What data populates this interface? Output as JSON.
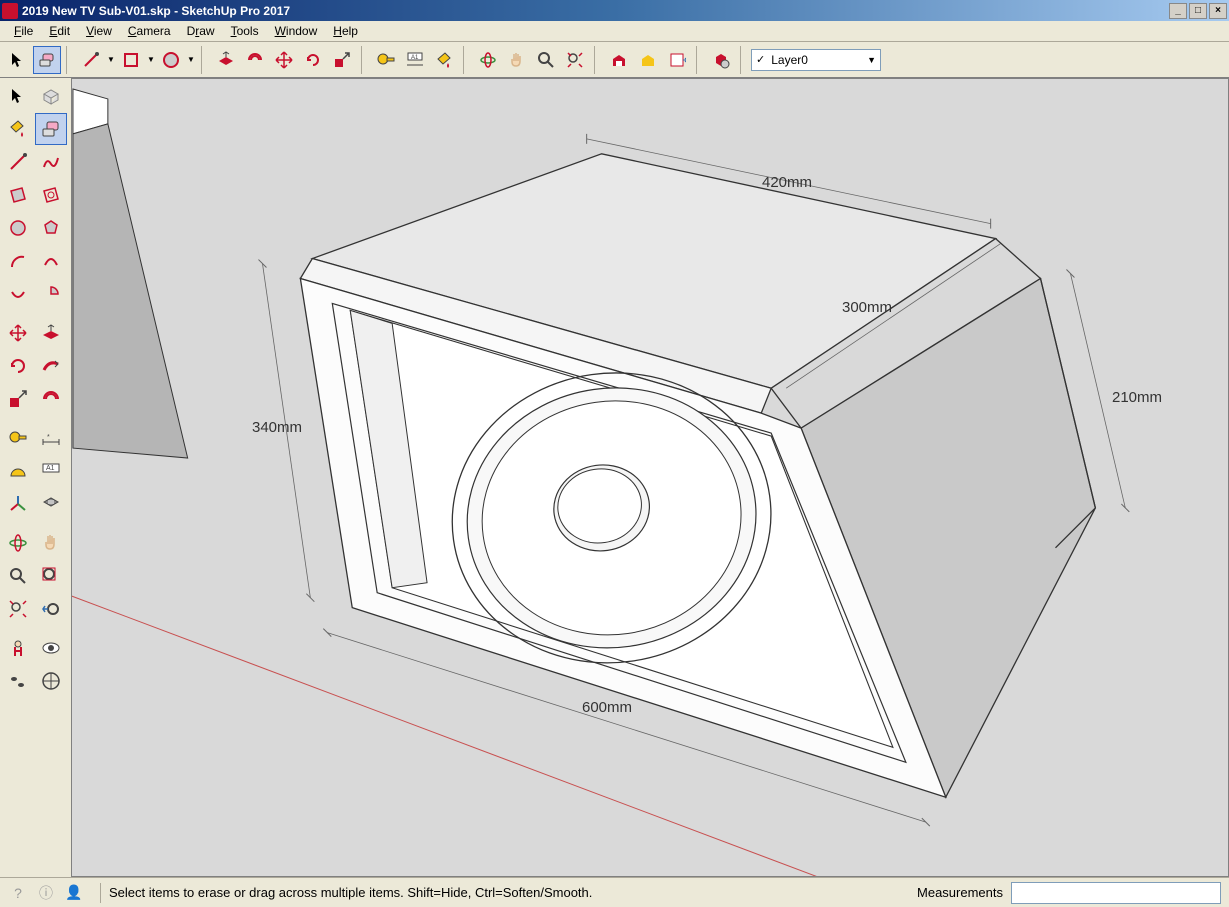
{
  "title": "2019 New TV Sub-V01.skp - SketchUp Pro 2017",
  "menu": [
    "File",
    "Edit",
    "View",
    "Camera",
    "Draw",
    "Tools",
    "Window",
    "Help"
  ],
  "layer_selected": "Layer0",
  "status": {
    "hint": "Select items to erase or drag across multiple items. Shift=Hide, Ctrl=Soften/Smooth.",
    "measurements_label": "Measurements",
    "measurements_value": ""
  },
  "dimensions": {
    "width_top": "420mm",
    "depth": "300mm",
    "side_right": "210mm",
    "height_left": "340mm",
    "width_bottom": "600mm"
  },
  "toolbar_top": {
    "select": "Select",
    "eraser": "Eraser",
    "line": "Line",
    "shapes": "Shapes",
    "arcs": "Arcs",
    "pushpull": "Push/Pull",
    "offset": "Offset",
    "move": "Move",
    "rotate": "Rotate",
    "scale": "Scale",
    "tape": "Tape Measure",
    "dimension": "Dimension",
    "paintbucket": "Paint Bucket",
    "orbit": "Orbit",
    "pan": "Pan",
    "zoom": "Zoom",
    "zoomextents": "Zoom Extents",
    "warehouse3d": "3D Warehouse",
    "warehouseext": "Extension Warehouse",
    "layout": "Send to LayOut",
    "extmgr": "Extension Manager"
  },
  "toolbar_side": {
    "select": "Select",
    "makecomp": "Make Component",
    "paint": "Paint Bucket",
    "eraser": "Eraser",
    "line": "Line",
    "freehand": "Freehand",
    "rect": "Rectangle",
    "rotrect": "Rotated Rectangle",
    "circle": "Circle",
    "polygon": "Polygon",
    "arc": "Arc",
    "arc2": "2 Point Arc",
    "arc3": "3 Point Arc",
    "pie": "Pie",
    "move": "Move",
    "pushpull": "Push/Pull",
    "rotate": "Rotate",
    "followme": "Follow Me",
    "scale": "Scale",
    "offset": "Offset",
    "tape": "Tape Measure",
    "dimension": "Dimension",
    "protractor": "Protractor",
    "text": "Text",
    "axes": "Axes",
    "section": "Section Plane",
    "orbit": "Orbit",
    "pan": "Pan",
    "zoom": "Zoom",
    "zoomwin": "Zoom Window",
    "zoomext": "Zoom Extents",
    "prevview": "Previous View",
    "position": "Position Camera",
    "lookaround": "Look Around",
    "walk": "Walk",
    "modelinfo": "Model Info"
  }
}
